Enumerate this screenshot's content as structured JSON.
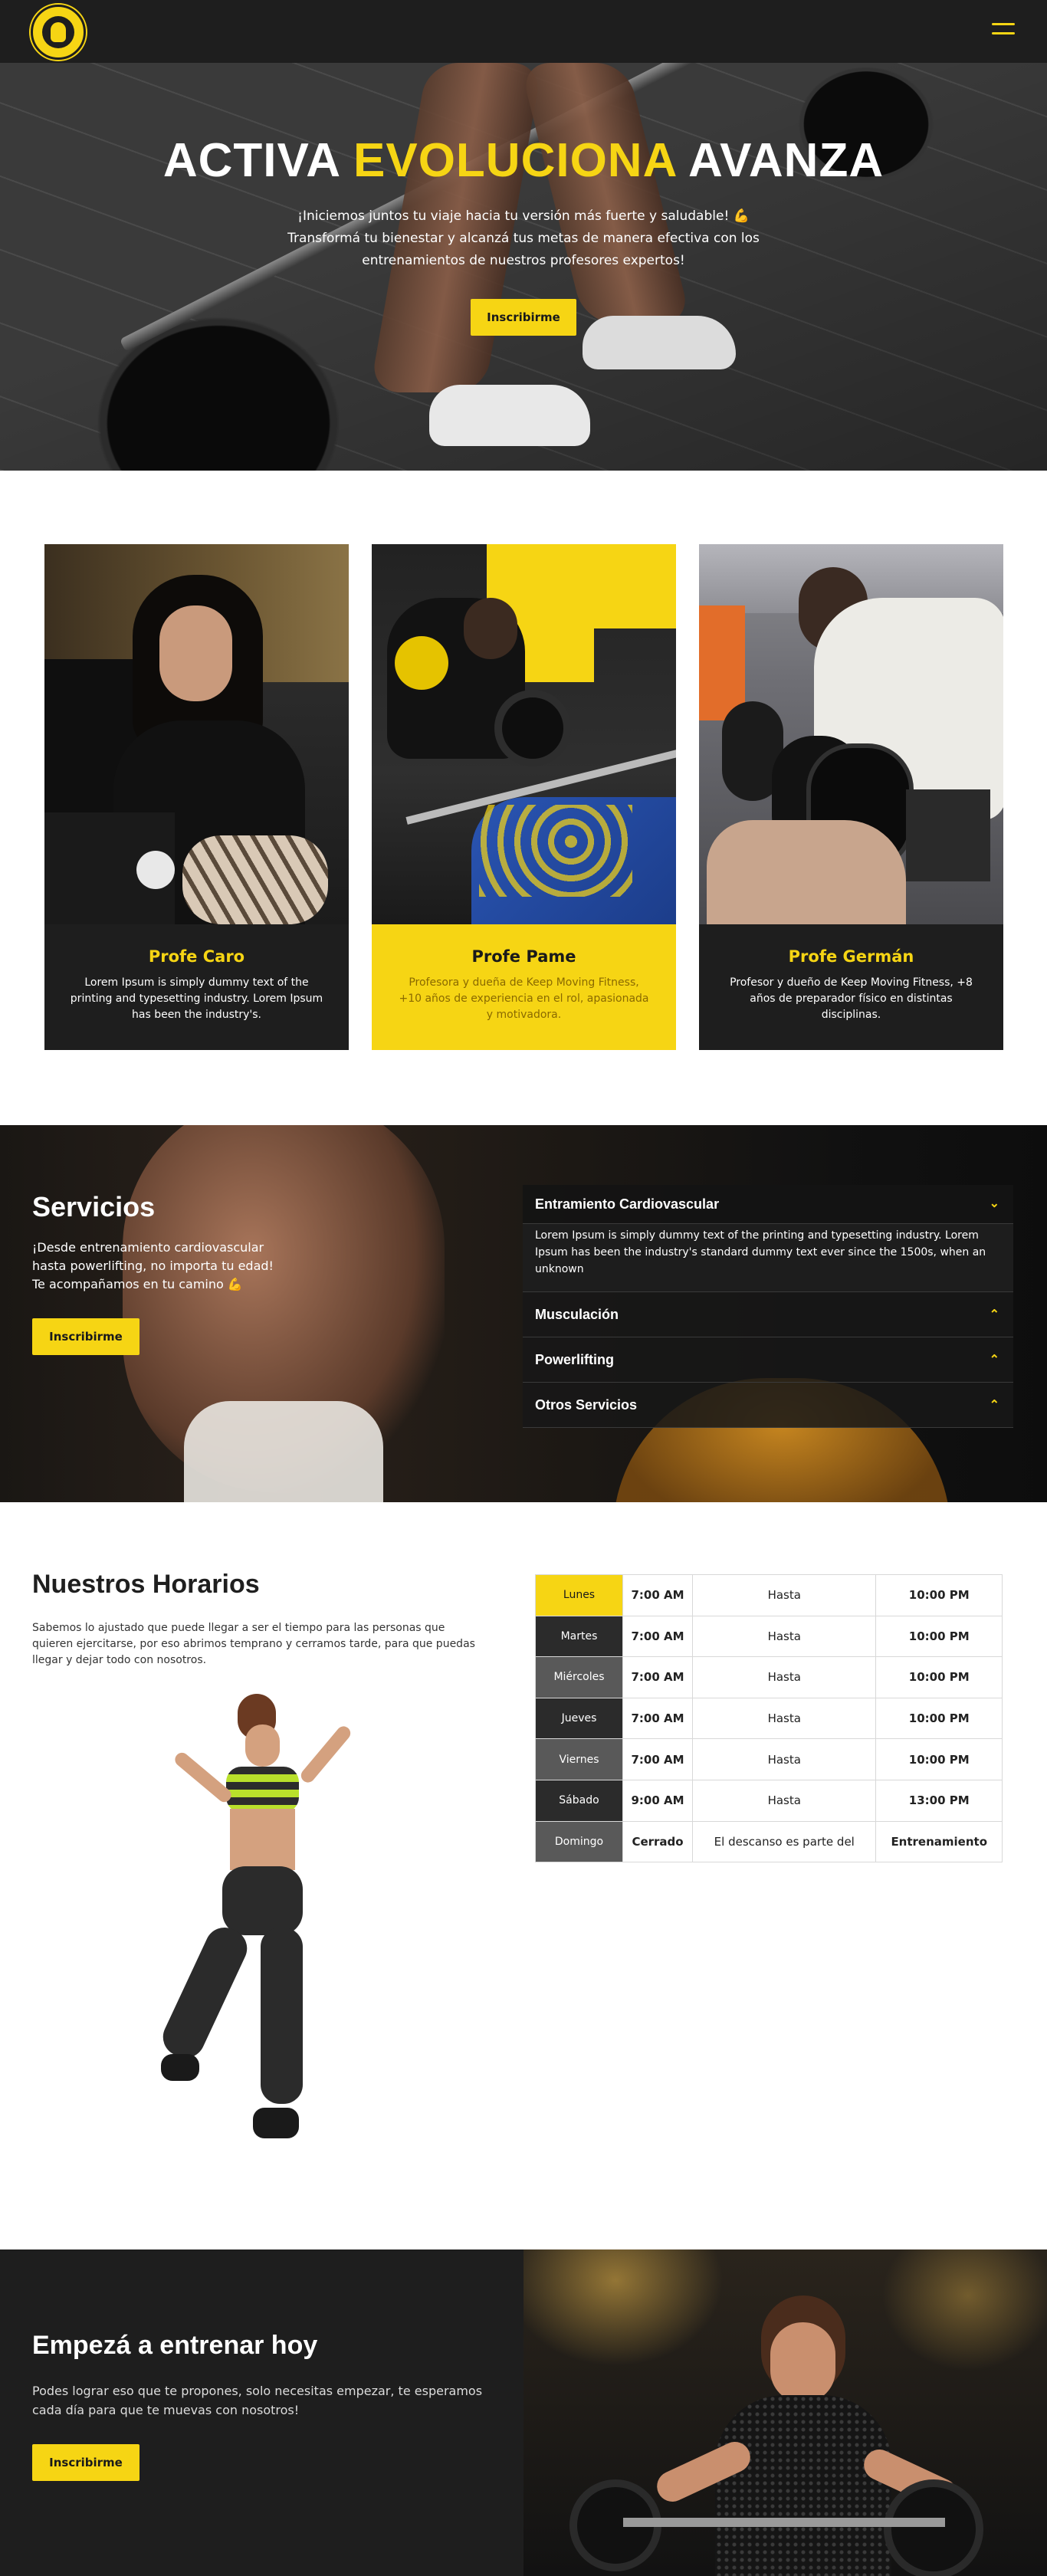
{
  "nav": {
    "logo_alt": "Keep Moving Fitness",
    "menu_icon": "hamburger-menu-icon",
    "accent": "#f6d514"
  },
  "hero": {
    "title_part1": "ACTIVA",
    "title_part2": "EVOLUCIONA",
    "title_part3": "AVANZA",
    "line1": "¡Iniciemos juntos tu viaje hacia tu versión más fuerte y saludable! 💪",
    "line2": "Transformá tu bienestar y alcanzá tus metas de manera efectiva con los entrenamientos de nuestros profesores expertos!",
    "cta": "Inscribirme"
  },
  "team": [
    {
      "name": "Profe Caro",
      "desc": "Lorem Ipsum is simply dummy text of the printing and typesetting industry. Lorem Ipsum has been the industry's."
    },
    {
      "name": "Profe Pame",
      "desc": "Profesora y dueña de Keep Moving Fitness, +10 años de experiencia en el rol, apasionada y motivadora."
    },
    {
      "name": "Profe Germán",
      "desc": "Profesor y dueño de Keep Moving Fitness, +8 años de preparador físico en distintas disciplinas."
    }
  ],
  "services": {
    "title": "Servicios",
    "text": "¡Desde entrenamiento cardiovascular hasta powerlifting, no importa tu edad! Te acompañamos en tu camino 💪",
    "cta": "Inscribirme",
    "items": [
      {
        "label": "Entramiento Cardiovascular",
        "open": true,
        "body": "Lorem Ipsum is simply dummy text of the printing and typesetting industry. Lorem Ipsum has been the industry's standard dummy text ever since the 1500s, when an unknown"
      },
      {
        "label": "Musculación",
        "open": false
      },
      {
        "label": "Powerlifting",
        "open": false
      },
      {
        "label": "Otros Servicios",
        "open": false
      }
    ]
  },
  "schedule": {
    "title": "Nuestros Horarios",
    "text": "Sabemos lo ajustado que puede llegar a ser el tiempo para las personas que quieren ejercitarse, por eso abrimos temprano y cerramos tarde, para que puedas llegar y dejar todo con nosotros.",
    "rows": [
      {
        "day": "Lunes",
        "from": "7:00 AM",
        "sep": "Hasta",
        "to": "10:00 PM"
      },
      {
        "day": "Martes",
        "from": "7:00 AM",
        "sep": "Hasta",
        "to": "10:00 PM"
      },
      {
        "day": "Miércoles",
        "from": "7:00 AM",
        "sep": "Hasta",
        "to": "10:00 PM"
      },
      {
        "day": "Jueves",
        "from": "7:00 AM",
        "sep": "Hasta",
        "to": "10:00 PM"
      },
      {
        "day": "Viernes",
        "from": "7:00 AM",
        "sep": "Hasta",
        "to": "10:00 PM"
      },
      {
        "day": "Sábado",
        "from": "9:00 AM",
        "sep": "Hasta",
        "to": "13:00 PM"
      },
      {
        "day": "Domingo",
        "from": "Cerrado",
        "sep": "El descanso es parte del",
        "to": "Entrenamiento"
      }
    ]
  },
  "cta": {
    "title": "Empezá a entrenar hoy",
    "text": "Podes lograr eso que te propones, solo necesitas empezar, te esperamos cada día para que te muevas con nosotros!",
    "button": "Inscribirme"
  }
}
